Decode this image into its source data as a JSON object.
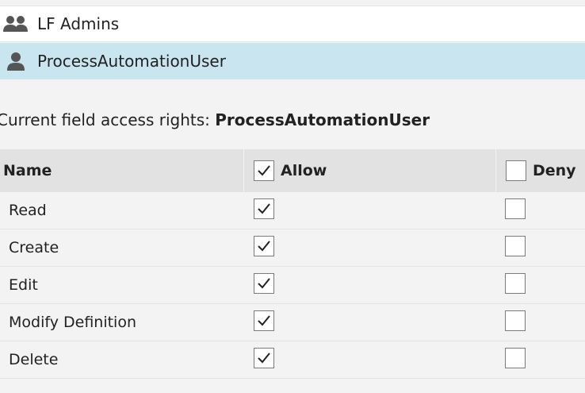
{
  "principals": [
    {
      "name": "LF Admins",
      "icon": "group-icon",
      "selected": false
    },
    {
      "name": "ProcessAutomationUser",
      "icon": "user-icon",
      "selected": true
    }
  ],
  "rights": {
    "title_prefix": "Current field access rights: ",
    "title_user": "ProcessAutomationUser",
    "headers": {
      "name": "Name",
      "allow": "Allow",
      "deny": "Deny"
    },
    "header_allow_checked": true,
    "header_deny_checked": false,
    "rows": [
      {
        "name": "Read",
        "allow": true,
        "deny": false
      },
      {
        "name": "Create",
        "allow": true,
        "deny": false
      },
      {
        "name": "Edit",
        "allow": true,
        "deny": false
      },
      {
        "name": "Modify Definition",
        "allow": true,
        "deny": false
      },
      {
        "name": "Delete",
        "allow": true,
        "deny": false
      }
    ]
  },
  "colors": {
    "selected_row": "#c9e5ef",
    "header_bg": "#e2e2e2",
    "page_bg": "#f3f3f3"
  }
}
